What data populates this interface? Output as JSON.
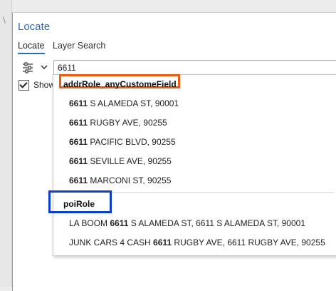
{
  "pane": {
    "title": "Locate"
  },
  "tabs": [
    {
      "label": "Locate",
      "active": true
    },
    {
      "label": "Layer Search",
      "active": false
    }
  ],
  "search": {
    "value": "6611"
  },
  "show_option": {
    "label": "Show",
    "checked": true
  },
  "colors": {
    "accent": "#2a6ebb",
    "addr_highlight": "#ea5a0f",
    "poi_highlight": "#0b3fc7"
  },
  "dropdown": {
    "groups": [
      {
        "header": "addrRole_anyCustomeField",
        "items": [
          {
            "bold": "6611",
            "rest": " S ALAMEDA ST, 90001"
          },
          {
            "bold": "6611",
            "rest": " RUGBY AVE, 90255"
          },
          {
            "bold": "6611",
            "rest": " PACIFIC BLVD, 90255"
          },
          {
            "bold": "6611",
            "rest": " SEVILLE AVE, 90255"
          },
          {
            "bold": "6611",
            "rest": " MARCONI ST, 90255"
          }
        ]
      },
      {
        "header": "poiRole",
        "items": [
          {
            "pre": "LA BOOM ",
            "bold": "6611",
            "rest": " S ALAMEDA ST, 6611 S ALAMEDA ST, 90001"
          },
          {
            "pre": "JUNK CARS 4 CASH ",
            "bold": "6611",
            "rest": " RUGBY AVE, 6611 RUGBY AVE, 90255"
          }
        ]
      }
    ]
  }
}
